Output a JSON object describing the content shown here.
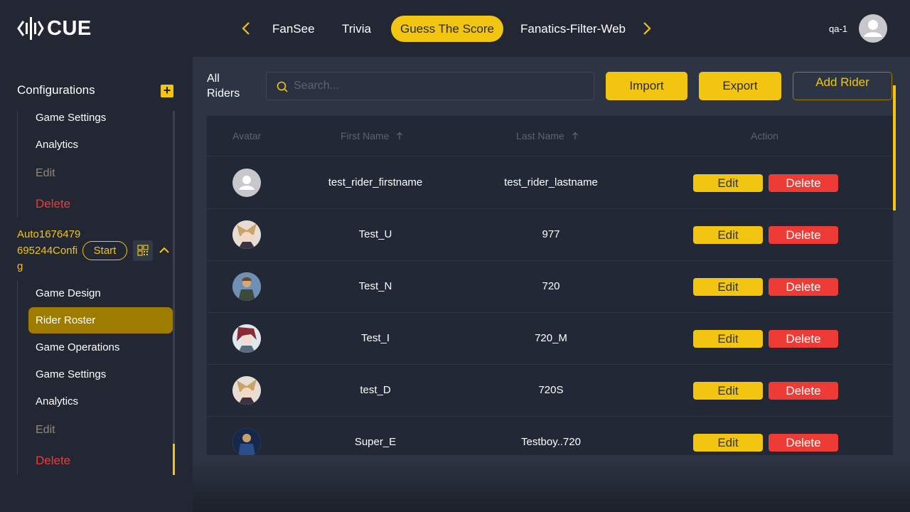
{
  "header": {
    "logo_text": "CUE",
    "tabs": [
      {
        "label": "FanSee"
      },
      {
        "label": "Trivia"
      },
      {
        "label": "Guess The Score"
      },
      {
        "label": "Fanatics-Filter-Web"
      }
    ],
    "active_tab": "Guess The Score",
    "user_name": "qa-1"
  },
  "sidebar": {
    "title": "Configurations",
    "top_items": [
      "Game Settings",
      "Analytics",
      "Edit",
      "Delete"
    ],
    "config_name": "Auto1676479695244Config",
    "start_label": "Start",
    "sub_items": [
      "Game Design",
      "Rider Roster",
      "Game Operations",
      "Game Settings",
      "Analytics",
      "Edit",
      "Delete"
    ],
    "selected_item": "Rider Roster"
  },
  "main": {
    "title": "All Riders",
    "search_placeholder": "Search...",
    "import_label": "Import",
    "export_label": "Export",
    "add_label": "Add Rider"
  },
  "table": {
    "headers": {
      "avatar": "Avatar",
      "first": "First Name",
      "last": "Last Name",
      "action": "Action"
    },
    "edit_label": "Edit",
    "delete_label": "Delete",
    "rows": [
      {
        "first": "test_rider_firstname",
        "last": "test_rider_lastname",
        "avatar": "default-avatar-icon"
      },
      {
        "first": "Test_U",
        "last": "977",
        "avatar": "character-portrait"
      },
      {
        "first": "Test_N",
        "last": "720",
        "avatar": "character-portrait"
      },
      {
        "first": "Test_I",
        "last": "720_M",
        "avatar": "character-portrait"
      },
      {
        "first": "test_D",
        "last": "720S",
        "avatar": "character-portrait"
      },
      {
        "first": "Super_E",
        "last": "Testboy..720",
        "avatar": "character-portrait"
      }
    ]
  },
  "colors": {
    "accent": "#f2c511",
    "danger": "#ef3b35",
    "selected": "#9e7c00",
    "background": "#222733",
    "panel": "#2d3444"
  }
}
